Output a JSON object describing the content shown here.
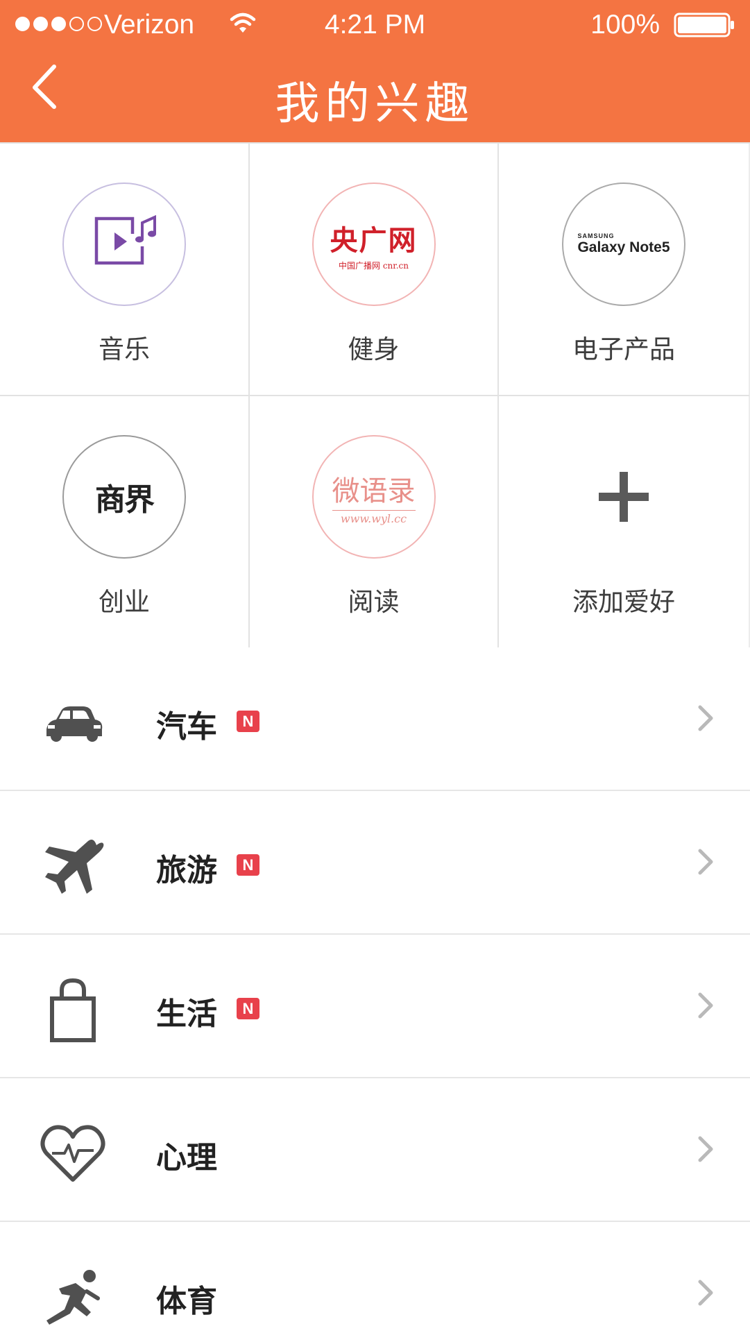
{
  "status_bar": {
    "carrier": "Verizon",
    "time": "4:21 PM",
    "battery": "100%",
    "signal_bars_filled": 3,
    "signal_bars_total": 5
  },
  "nav": {
    "title": "我的兴趣",
    "back_icon": "chevron-left-icon"
  },
  "accent_color": "#F47442",
  "interests": [
    {
      "label": "音乐",
      "logo": "music-video-icon"
    },
    {
      "label": "健身",
      "logo": "cnr-logo",
      "logo_text": "央广网",
      "logo_sub": "中国广播网 cnr.cn"
    },
    {
      "label": "电子产品",
      "logo": "samsung-galaxy-note5-logo",
      "logo_text": "Galaxy Note5",
      "logo_sub": "SAMSUNG"
    },
    {
      "label": "创业",
      "logo": "shangjie-logo",
      "logo_text": "商界"
    },
    {
      "label": "阅读",
      "logo": "wyl-logo",
      "logo_text": "微语录",
      "logo_sub": "www.wyl.cc"
    },
    {
      "label": "添加爱好",
      "logo": "plus-icon"
    }
  ],
  "categories": [
    {
      "label": "汽车",
      "icon": "car-icon",
      "badge": "N"
    },
    {
      "label": "旅游",
      "icon": "airplane-icon",
      "badge": "N"
    },
    {
      "label": "生活",
      "icon": "shopping-bag-icon",
      "badge": "N"
    },
    {
      "label": "心理",
      "icon": "heart-pulse-icon",
      "badge": ""
    },
    {
      "label": "体育",
      "icon": "runner-icon",
      "badge": ""
    }
  ]
}
